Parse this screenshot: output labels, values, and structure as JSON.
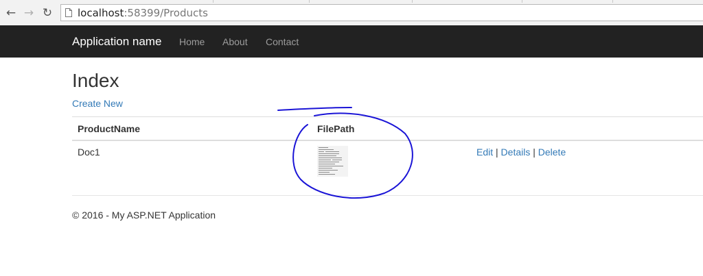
{
  "browser": {
    "url_host": "localhost",
    "url_rest": ":58399/Products"
  },
  "navbar": {
    "brand": "Application name",
    "links": [
      "Home",
      "About",
      "Contact"
    ]
  },
  "page": {
    "title": "Index",
    "create_link": "Create New"
  },
  "table": {
    "headers": [
      "ProductName",
      "FilePath"
    ],
    "rows": [
      {
        "product_name": "Doc1"
      }
    ],
    "actions": {
      "edit": "Edit",
      "details": "Details",
      "delete": "Delete",
      "separator": "|"
    }
  },
  "footer": {
    "text": "© 2016 - My ASP.NET Application"
  },
  "colors": {
    "navbar_bg": "#222222",
    "link": "#337ab7",
    "annotation": "#1a14d6"
  }
}
